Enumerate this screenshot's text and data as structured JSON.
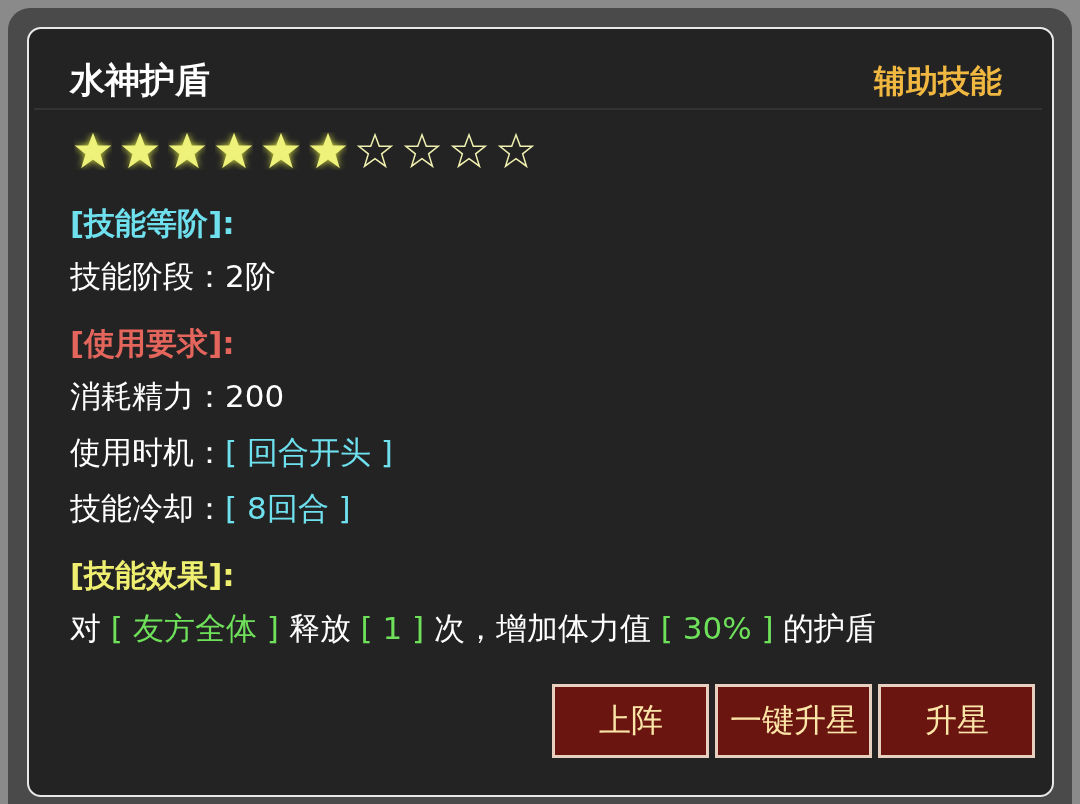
{
  "dialog": {
    "title": "水神护盾",
    "category": "辅助技能",
    "stars": 6
  },
  "sections": [
    {
      "heading": "[技能等阶]:",
      "color": "#6ee0ee",
      "lines": [
        [
          {
            "text": "技能阶段：",
            "kind": "plain"
          },
          {
            "text": "2阶",
            "kind": "plain"
          }
        ]
      ]
    },
    {
      "heading": "[使用要求]:",
      "color": "#e4655c",
      "lines": [
        [
          {
            "text": "消耗精力：",
            "kind": "plain"
          },
          {
            "text": "200",
            "kind": "plain"
          }
        ],
        [
          {
            "text": "使用时机：",
            "kind": "plain"
          },
          {
            "text": "[ 回合开头 ]",
            "kind": "info"
          }
        ],
        [
          {
            "text": "技能冷却：",
            "kind": "plain"
          },
          {
            "text": "[ 8回合 ]",
            "kind": "info"
          }
        ]
      ]
    },
    {
      "heading": "[技能效果]:",
      "color": "#eeee70",
      "lines": [
        [
          {
            "text": "对 ",
            "kind": "plain"
          },
          {
            "text": "[ 友方全体 ]",
            "kind": "effect"
          },
          {
            "text": " 释放 ",
            "kind": "plain"
          },
          {
            "text": "[ 1 ]",
            "kind": "effect"
          },
          {
            "text": " 次，增加体力值 ",
            "kind": "plain"
          },
          {
            "text": "[ 30% ]",
            "kind": "effect"
          },
          {
            "text": " 的护盾",
            "kind": "plain"
          }
        ]
      ]
    }
  ],
  "buttons": [
    "上阵",
    "一键升星",
    "升星"
  ]
}
